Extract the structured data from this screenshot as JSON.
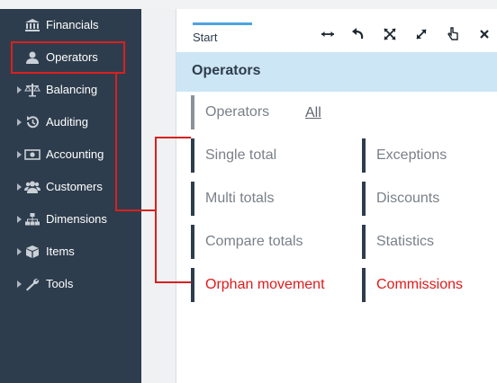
{
  "sidebar": {
    "items": [
      {
        "label": "Financials",
        "icon": "bank-icon",
        "has_caret": false
      },
      {
        "label": "Operators",
        "icon": "user-icon",
        "has_caret": false
      },
      {
        "label": "Balancing",
        "icon": "scale-icon",
        "has_caret": true
      },
      {
        "label": "Auditing",
        "icon": "history-icon",
        "has_caret": true
      },
      {
        "label": "Accounting",
        "icon": "money-icon",
        "has_caret": true
      },
      {
        "label": "Customers",
        "icon": "users-icon",
        "has_caret": true
      },
      {
        "label": "Dimensions",
        "icon": "sitemap-icon",
        "has_caret": true
      },
      {
        "label": "Items",
        "icon": "cube-icon",
        "has_caret": true
      },
      {
        "label": "Tools",
        "icon": "wrench-icon",
        "has_caret": true
      }
    ]
  },
  "tabs": {
    "start": "Start"
  },
  "toolbar": {
    "icons": [
      "expand-horizontal-icon",
      "undo-icon",
      "fullscreen-icon",
      "maximize-icon",
      "hand-pointer-icon",
      "close-icon"
    ]
  },
  "section": {
    "title": "Operators"
  },
  "links": {
    "operators": "Operators",
    "all": "All",
    "single_total": "Single total",
    "multi_totals": "Multi totals",
    "compare_totals": "Compare totals",
    "orphan_movement": "Orphan movement",
    "exceptions": "Exceptions",
    "discounts": "Discounts",
    "statistics": "Statistics",
    "commissions": "Commissions"
  },
  "colors": {
    "sidebar_bg": "#2e3d4d",
    "header_bg": "#cde6f5",
    "accent": "#4da3e0",
    "highlight_red": "#e11a1a",
    "annotation_red": "#d9201f"
  }
}
